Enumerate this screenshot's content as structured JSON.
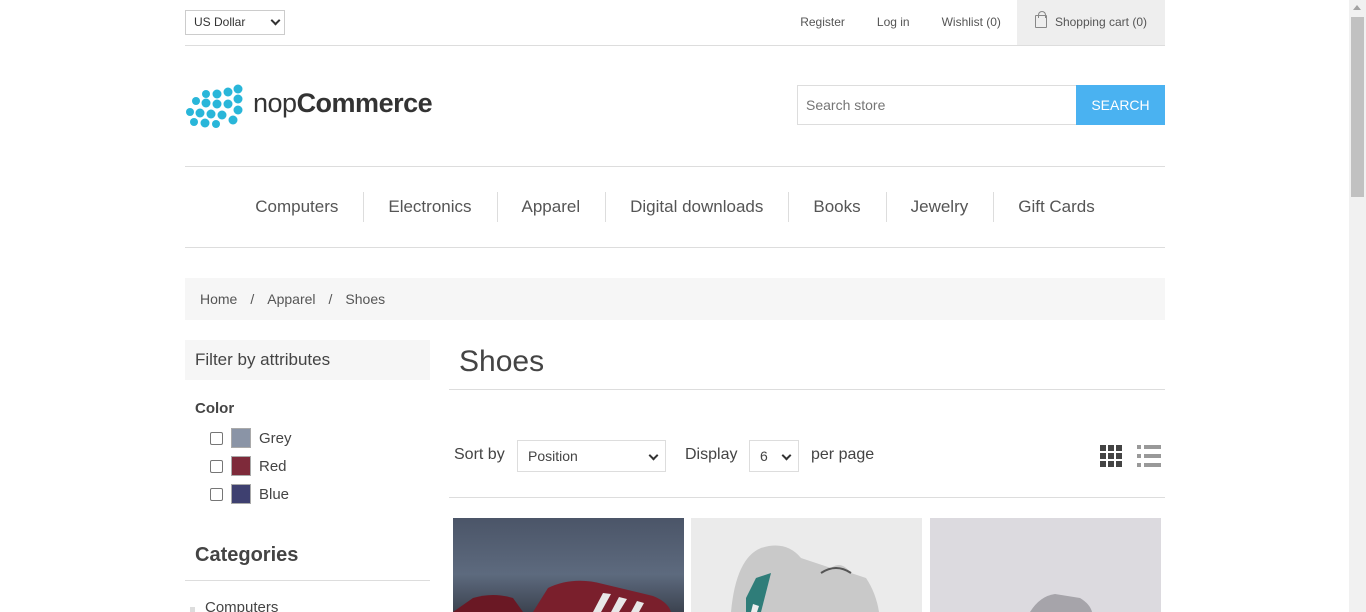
{
  "header": {
    "currency": "US Dollar",
    "links": [
      "Register",
      "Log in",
      "Wishlist (0)"
    ],
    "cart": "Shopping cart (0)"
  },
  "logo": {
    "text_light": "nop",
    "text_bold": "Commerce",
    "color": "#29b6d9"
  },
  "search": {
    "placeholder": "Search store",
    "button": "Search",
    "button_color": "#4ab2f1"
  },
  "menu": [
    "Computers",
    "Electronics",
    "Apparel",
    "Digital downloads",
    "Books",
    "Jewelry",
    "Gift Cards"
  ],
  "breadcrumb": [
    "Home",
    "Apparel",
    "Shoes"
  ],
  "sidebar": {
    "filter_title": "Filter by attributes",
    "color_label": "Color",
    "colors": [
      {
        "name": "Grey",
        "swatch": "#8a94a6"
      },
      {
        "name": "Red",
        "swatch": "#7e2a3a"
      },
      {
        "name": "Blue",
        "swatch": "#3e4070"
      }
    ],
    "categories_title": "Categories",
    "categories": [
      "Computers"
    ]
  },
  "main": {
    "title": "Shoes",
    "sort_label": "Sort by",
    "sort_value": "Position",
    "display_label": "Display",
    "display_value": "6",
    "per_page_label": "per page",
    "view_icons": [
      "grid-view-icon",
      "list-view-icon"
    ]
  }
}
